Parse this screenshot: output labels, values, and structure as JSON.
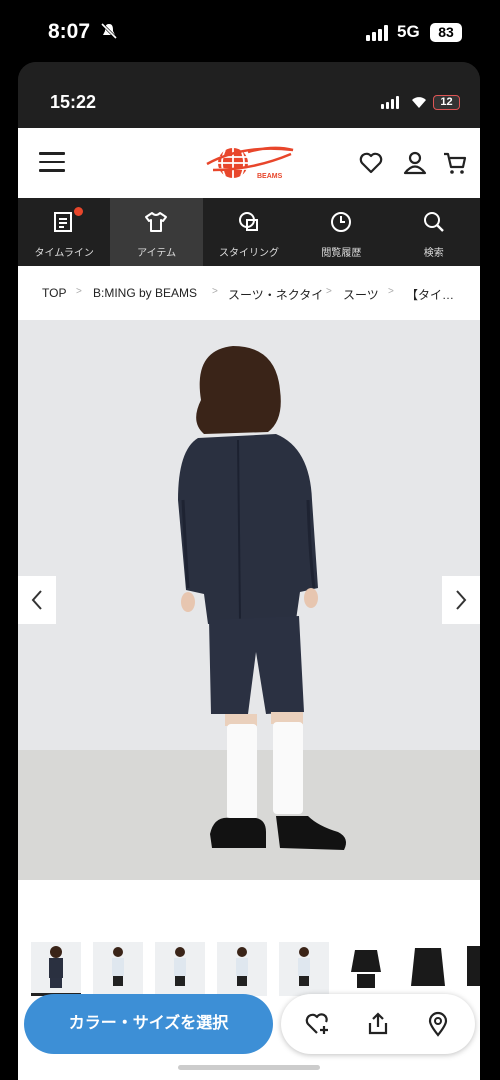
{
  "outer_status": {
    "time": "8:07",
    "network": "5G",
    "battery": "83"
  },
  "inner_status": {
    "time": "15:22",
    "battery": "12"
  },
  "header": {
    "brand": "BEAMS"
  },
  "tabs": [
    {
      "label": "タイムライン",
      "icon": "timeline-icon"
    },
    {
      "label": "アイテム",
      "icon": "tshirt-icon"
    },
    {
      "label": "スタイリング",
      "icon": "styling-icon"
    },
    {
      "label": "閲覧履歴",
      "icon": "clock-icon"
    },
    {
      "label": "検索",
      "icon": "search-icon"
    }
  ],
  "breadcrumb": [
    "TOP",
    "B:MING by BEAMS",
    "スーツ・ネクタイ",
    "スーツ",
    "【タイ…"
  ],
  "gallery": {
    "thumbnail_count": 8,
    "selected_index": 0
  },
  "cta": {
    "label": "カラー・サイズを選択"
  },
  "colors": {
    "cta": "#3d8fd6",
    "dark_bar": "#202020",
    "badge": "#e8462b",
    "logo": "#e8462b"
  }
}
